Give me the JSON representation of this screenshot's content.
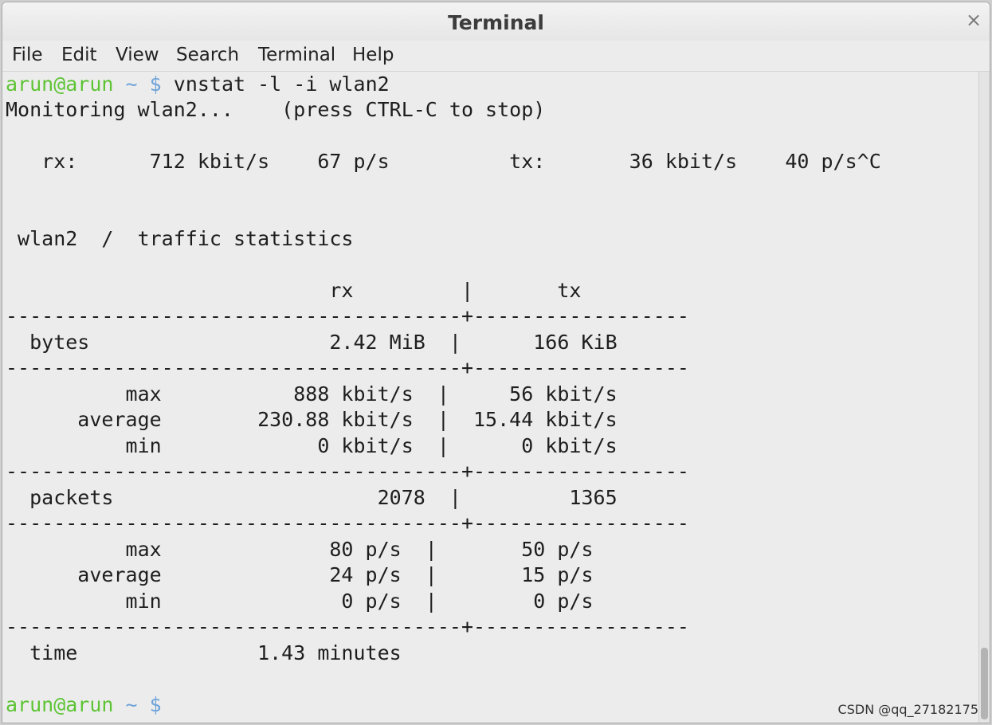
{
  "window": {
    "title": "Terminal",
    "close_glyph": "×"
  },
  "menu": [
    "File",
    "Edit",
    "View",
    "Search",
    "Terminal",
    "Help"
  ],
  "prompt": {
    "user": "arun@arun",
    "tilde": "~",
    "dollar": "$"
  },
  "command": " vnstat -l -i wlan2",
  "terminal": {
    "monitoring": "Monitoring wlan2...    (press CTRL-C to stop)",
    "live": "   rx:      712 kbit/s    67 p/s          tx:       36 kbit/s    40 p/s^C",
    "heading": " wlan2  /  traffic statistics",
    "col_header": "                           rx         |       tx",
    "sep1": "--------------------------------------+------------------",
    "bytes": "  bytes                    2.42 MiB  |      166 KiB",
    "sep2": "--------------------------------------+------------------",
    "bytes_max": "          max           888 kbit/s  |     56 kbit/s",
    "bytes_avg": "      average        230.88 kbit/s  |  15.44 kbit/s",
    "bytes_min": "          min             0 kbit/s  |      0 kbit/s",
    "sep3": "--------------------------------------+------------------",
    "packets": "  packets                      2078  |         1365",
    "sep4": "--------------------------------------+------------------",
    "pk_max": "          max              80 p/s  |       50 p/s",
    "pk_avg": "      average              24 p/s  |       15 p/s",
    "pk_min": "          min               0 p/s  |        0 p/s",
    "sep5": "--------------------------------------+------------------",
    "time": "  time               1.43 minutes"
  },
  "watermark": "CSDN @qq_27182175"
}
